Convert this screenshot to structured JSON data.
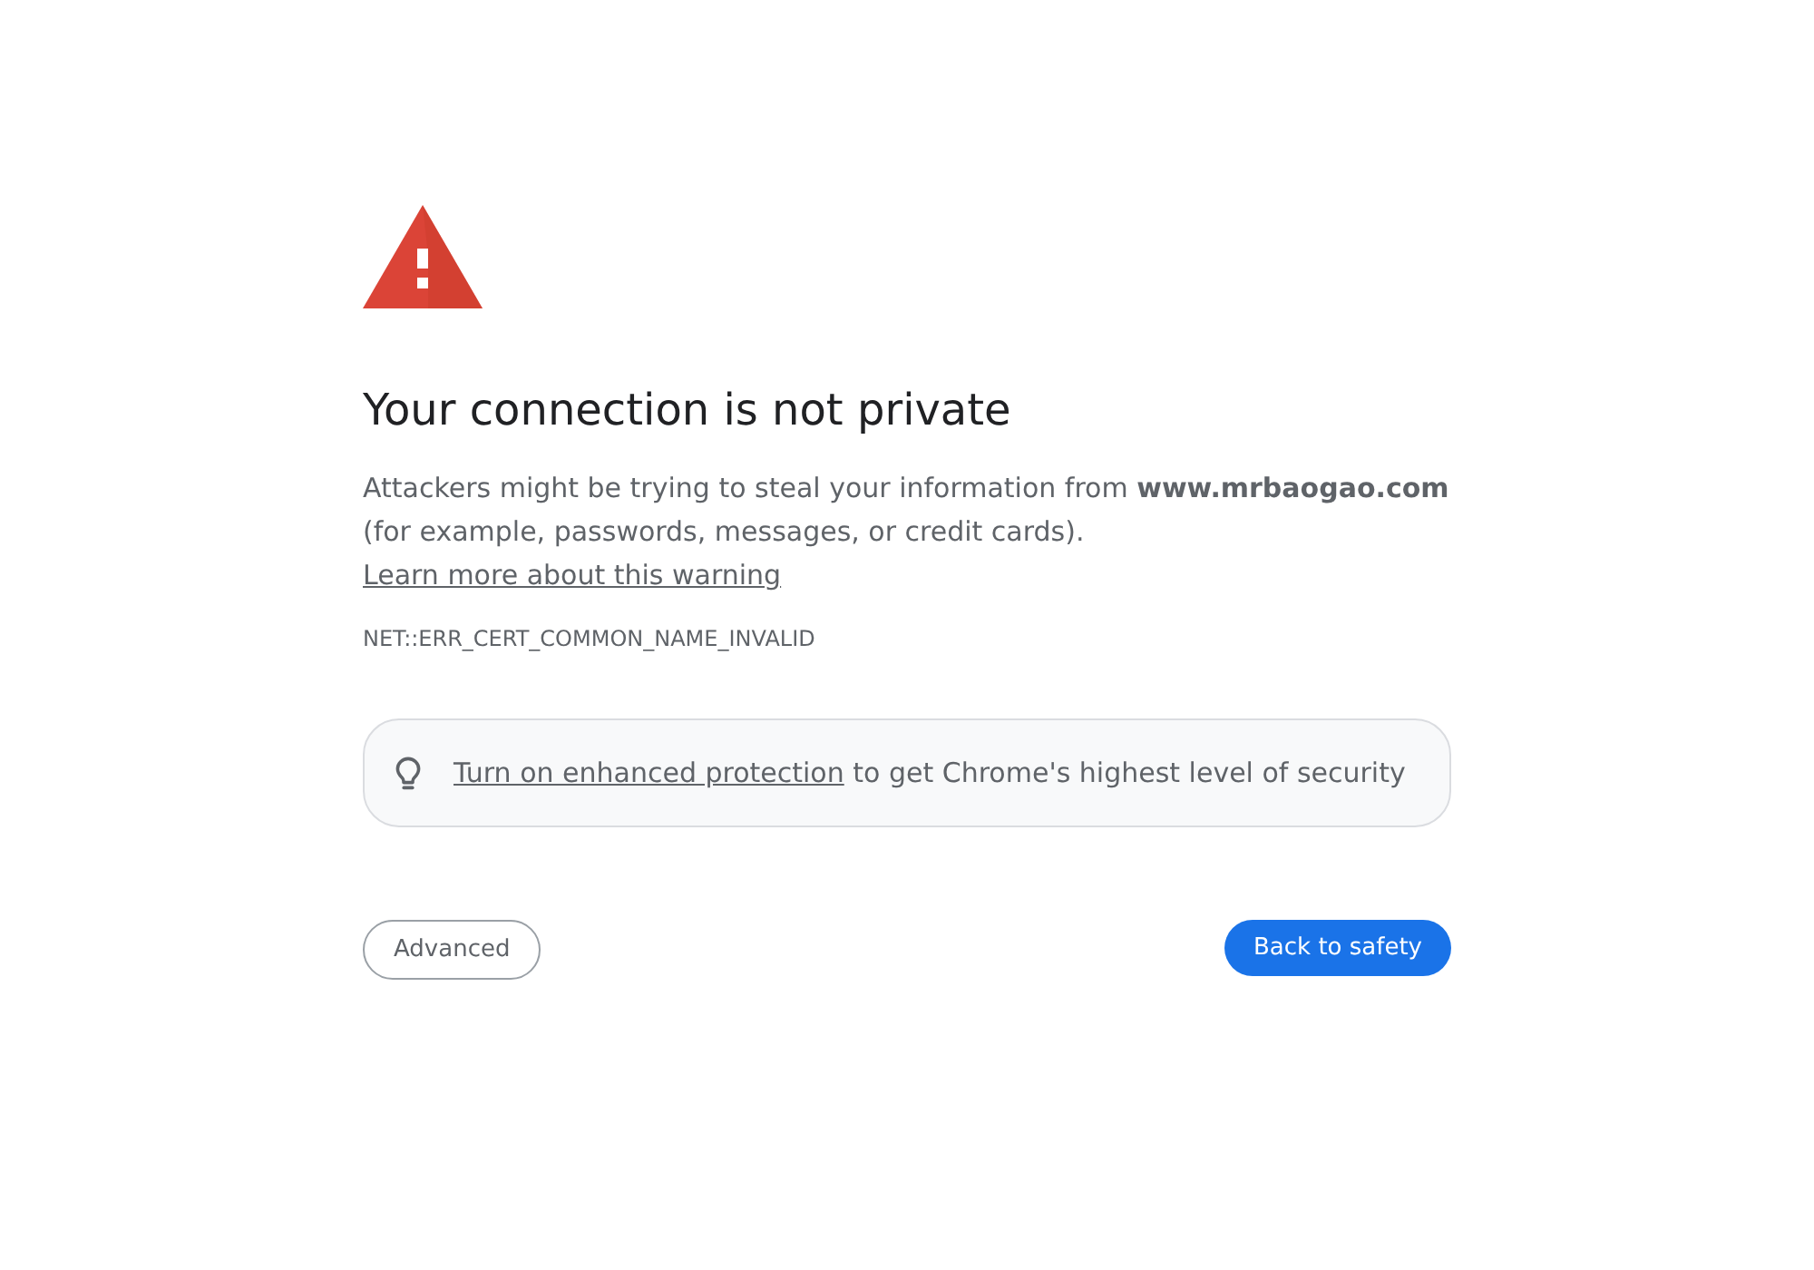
{
  "heading": "Your connection is not private",
  "message": {
    "text": "Attackers might be trying to steal your information from **www.mrbaogao.com** (for example, passwords, messages, or credit cards).",
    "link": "Learn more about this warning"
  },
  "error_code": "NET::ERR_CERT_COMMON_NAME_INVALID",
  "protection_banner": {
    "link": "Turn on enhanced protection",
    "text": "to get Chrome's highest level of security"
  },
  "buttons": [
    {
      "label": "Advanced",
      "kind": "secondary"
    },
    {
      "label": "Back to safety",
      "kind": "primary"
    }
  ]
}
